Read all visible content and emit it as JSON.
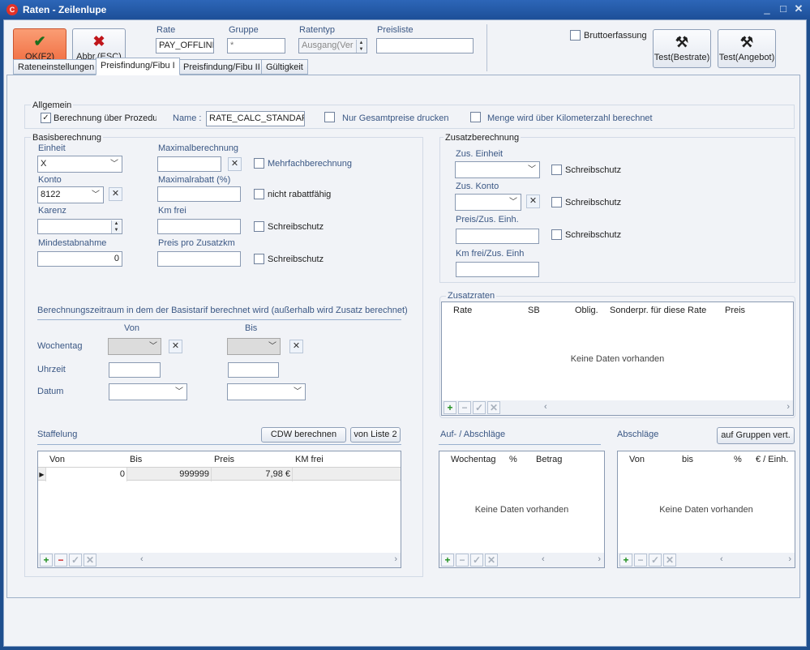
{
  "window": {
    "title": "Raten - Zeilenlupe",
    "app_icon": "C"
  },
  "toolbar": {
    "ok_label": "OK(F2)",
    "cancel_label": "Abbr.(ESC)",
    "rate_label": "Rate",
    "rate_value": "PAY_OFFLINE",
    "gruppe_label": "Gruppe",
    "gruppe_value": "*",
    "ratentyp_label": "Ratentyp",
    "ratentyp_value": "Ausgang(Ver",
    "preisliste_label": "Preisliste",
    "preisliste_value": "",
    "brutto_label": "Bruttoerfassung",
    "test_bestrate_label": "Test(Bestrate)",
    "test_angebot_label": "Test(Angebot)"
  },
  "tabs": [
    {
      "label": "Rateneinstellungen"
    },
    {
      "label": "Preisfindung/Fibu I"
    },
    {
      "label": "Preisfindung/Fibu II"
    },
    {
      "label": "Gültigkeit"
    }
  ],
  "allgemein": {
    "title": "Allgemein",
    "calc_label": "Berechnung über Prozedur",
    "name_label": "Name :",
    "name_value": "RATE_CALC_STANDARD",
    "gesamt_label": "Nur Gesamtpreise drucken",
    "km_label": "Menge wird über Kilometerzahl berechnet"
  },
  "basis": {
    "title": "Basisberechnung",
    "einheit_label": "Einheit",
    "einheit_value": "X",
    "konto_label": "Konto",
    "konto_value": "8122",
    "karenz_label": "Karenz",
    "karenz_value": "",
    "mindest_label": "Mindestabnahme",
    "mindest_value": "0",
    "maxber_label": "Maximalberechnung",
    "maxrab_label": "Maximalrabatt (%)",
    "kmfrei_label": "Km frei",
    "preiszkm_label": "Preis pro Zusatzkm",
    "mehrfach_label": "Mehrfachberechnung",
    "nichtrab_label": "nicht rabattfähig",
    "schreib1_label": "Schreibschutz",
    "schreib2_label": "Schreibschutz"
  },
  "zeitraum": {
    "title": "Berechnungszeitraum in dem der Basistarif berechnet wird (außerhalb wird Zusatz berechnet)",
    "von_label": "Von",
    "bis_label": "Bis",
    "wochentag_label": "Wochentag",
    "uhrzeit_label": "Uhrzeit",
    "datum_label": "Datum"
  },
  "staffelung": {
    "title": "Staffelung",
    "cdw_label": "CDW berechnen",
    "liste_label": "von Liste 2",
    "columns": [
      "Von",
      "Bis",
      "Preis",
      "KM frei"
    ],
    "rows": [
      {
        "von": "0",
        "bis": "999999",
        "preis": "7,98 €",
        "kmfrei": ""
      }
    ]
  },
  "zusatz": {
    "title": "Zusatzberechnung",
    "einheit_label": "Zus. Einheit",
    "konto_label": "Zus. Konto",
    "preis_label": "Preis/Zus. Einh.",
    "kmfrei_label": "Km frei/Zus. Einh",
    "schreib1_label": "Schreibschutz",
    "schreib2_label": "Schreibschutz",
    "schreib3_label": "Schreibschutz"
  },
  "zusatzraten": {
    "title": "Zusatzraten",
    "columns": [
      "Rate",
      "SB",
      "Oblig.",
      "Sonderpr. für diese Rate",
      "Preis"
    ],
    "empty": "Keine Daten vorhanden"
  },
  "aufab": {
    "title": "Auf- / Abschläge",
    "columns": [
      "Wochentag",
      "%",
      "Betrag"
    ],
    "empty": "Keine Daten vorhanden"
  },
  "abschlaege": {
    "title": "Abschläge",
    "btn_label": "auf Gruppen vert.",
    "columns": [
      "Von",
      "bis",
      "%",
      "€ / Einh."
    ],
    "empty": "Keine Daten vorhanden"
  },
  "icons": {
    "ok": "checkmark-icon",
    "cancel": "x-icon",
    "test": "tools-icon"
  },
  "colors": {
    "titlebar": "#1d4f98",
    "ok_button": "#f06a3e",
    "cancel_x": "#c0161b",
    "add": "#1e8f1e",
    "delete": "#cc1e1e"
  }
}
